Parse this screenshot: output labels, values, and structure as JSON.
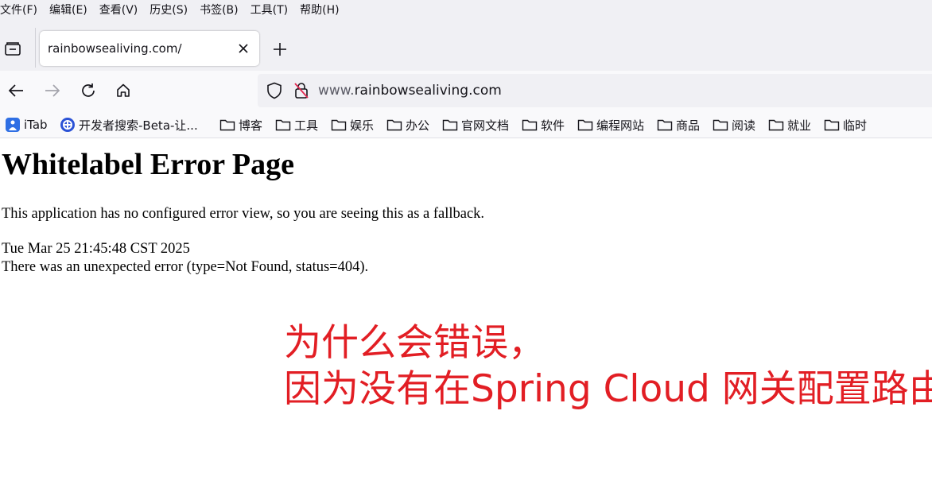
{
  "menubar": {
    "items": [
      "文件(F)",
      "编辑(E)",
      "查看(V)",
      "历史(S)",
      "书签(B)",
      "工具(T)",
      "帮助(H)"
    ]
  },
  "tab": {
    "title": "rainbowsealiving.com/"
  },
  "urlbar": {
    "prefix": "www.",
    "domain": "rainbowsealiving.com"
  },
  "bookmarks": {
    "itab": "iTab",
    "search": "开发者搜索-Beta-让...",
    "folders": [
      "博客",
      "工具",
      "娱乐",
      "办公",
      "官网文档",
      "软件",
      "编程网站",
      "商品",
      "阅读",
      "就业",
      "临时"
    ]
  },
  "page": {
    "title": "Whitelabel Error Page",
    "message": "This application has no configured error view, so you are seeing this as a fallback.",
    "timestamp": "Tue Mar 25 21:45:48 CST 2025",
    "error": "There was an unexpected error (type=Not Found, status=404)."
  },
  "annotation": {
    "line1": "为什么会错误，",
    "line2": "因为没有在Spring Cloud 网关配置路由",
    "color": "#e21e24"
  }
}
